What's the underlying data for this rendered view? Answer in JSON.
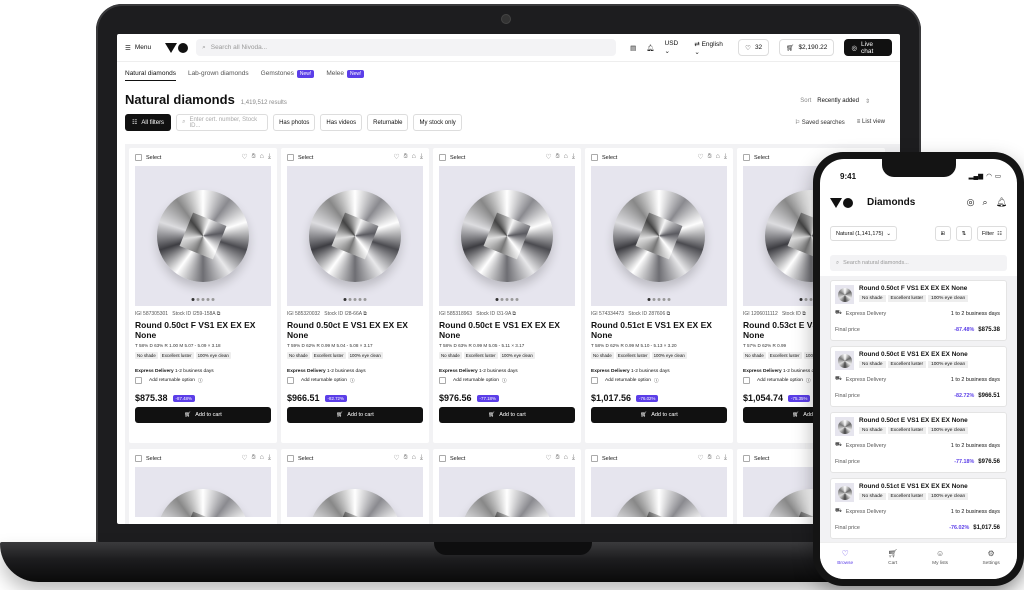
{
  "desktop": {
    "topbar": {
      "menu_label": "Menu",
      "search_placeholder": "Search all Nivoda...",
      "currency": "USD",
      "language": "English",
      "wishlist_count": "32",
      "cart_total": "$2,190.22",
      "live_chat": "Live chat"
    },
    "categories": [
      {
        "label": "Natural diamonds",
        "badge": ""
      },
      {
        "label": "Lab-grown diamonds",
        "badge": ""
      },
      {
        "label": "Gemstones",
        "badge": "New!"
      },
      {
        "label": "Melee",
        "badge": "New!"
      }
    ],
    "page_title": "Natural diamonds",
    "results_count": "1,419,512 results",
    "sort_label": "Sort",
    "sort_value": "Recently added",
    "filters": {
      "all_filters": "All filters",
      "search_placeholder": "Enter cert. number, Stock ID...",
      "chips": [
        "Has photos",
        "Has videos",
        "Returnable",
        "My stock only"
      ],
      "saved_searches": "Saved searches",
      "list_view": "List view"
    },
    "card_common": {
      "select": "Select",
      "express": "Express Delivery",
      "days": "1-2 business days",
      "returnable": "Add returnable option",
      "add_to_cart": "Add to cart",
      "tags": [
        "No shade",
        "Excellent luster",
        "100% eye clean"
      ]
    },
    "products": [
      {
        "igi": "IGI 587305301",
        "stock": "Stock ID I259-158A",
        "title": "Round 0.50ct F VS1 EX EX EX None",
        "specs": "T 58%  D 63%  R 1.00  M 5.07 - 5.09 × 3.18",
        "price": "$875.38",
        "discount": "-87.48%"
      },
      {
        "igi": "IGI 585320032",
        "stock": "Stock ID I28-66A",
        "title": "Round 0.50ct E VS1 EX EX EX None",
        "specs": "T 59%  D 62%  R 0.99  M 5.04 - 5.08 × 3.17",
        "price": "$966.51",
        "discount": "-82.72%"
      },
      {
        "igi": "IGI 585318963",
        "stock": "Stock ID I31-9A",
        "title": "Round 0.50ct E VS1 EX EX EX None",
        "specs": "T 58%  D 63%  R 0.99  M 5.05 - 5.11 × 3.17",
        "price": "$976.56",
        "discount": "-77.18%"
      },
      {
        "igi": "IGI 574334473",
        "stock": "Stock ID 287606",
        "title": "Round 0.51ct E VS1 EX EX EX None",
        "specs": "T 58%  D 62%  R 0.99  M 5.10 - 5.13 × 3.20",
        "price": "$1,017.56",
        "discount": "-76.02%"
      },
      {
        "igi": "IGI 1206011112",
        "stock": "Stock ID",
        "title": "Round 0.53ct E VS1 EX EX EX None",
        "specs": "T 57%  D 62%  R 0.99",
        "price": "$1,054.74",
        "discount": "-75.35%"
      }
    ]
  },
  "mobile": {
    "time": "9:41",
    "title": "Diamonds",
    "filter_dropdown": "Natural (1,141,175)",
    "filter_label": "Filter",
    "search_placeholder": "Search natural diamonds...",
    "express": "Express Delivery",
    "days": "1 to 2 business days",
    "final_price": "Final price",
    "tags": [
      "No shade",
      "Excellent luster",
      "100% eye clean"
    ],
    "items": [
      {
        "title": "Round 0.50ct F VS1 EX EX EX None",
        "discount": "-87.48%",
        "price": "$875.38"
      },
      {
        "title": "Round 0.50ct E VS1 EX EX EX None",
        "discount": "-82.72%",
        "price": "$966.51"
      },
      {
        "title": "Round 0.50ct E VS1 EX EX EX None",
        "discount": "-77.18%",
        "price": "$976.56"
      },
      {
        "title": "Round 0.51ct E VS1 EX EX EX None",
        "discount": "-76.02%",
        "price": "$1,017.56"
      }
    ],
    "tabs": [
      {
        "label": "Browse",
        "icon": "heart-icon"
      },
      {
        "label": "Cart",
        "icon": "cart-icon"
      },
      {
        "label": "My lists",
        "icon": "user-icon"
      },
      {
        "label": "Settings",
        "icon": "gear-icon"
      }
    ]
  },
  "colors": {
    "accent": "#5b3ee8",
    "dark": "#111111"
  }
}
